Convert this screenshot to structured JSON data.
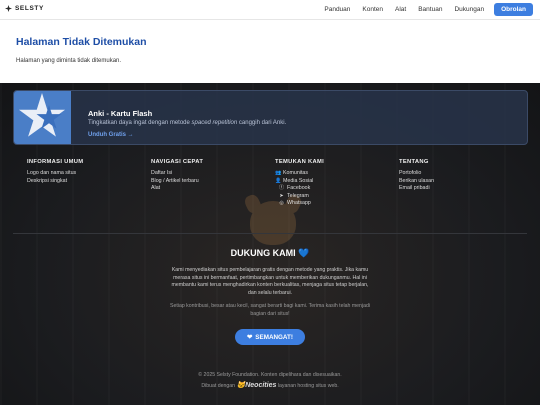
{
  "nav": {
    "brand": "SELSTY",
    "links": [
      "Panduan",
      "Konten",
      "Alat",
      "Bantuan",
      "Dukungan"
    ],
    "cta": "Obrolan"
  },
  "main": {
    "title": "Halaman Tidak Ditemukan",
    "message": "Halaman yang diminta tidak ditemukan."
  },
  "anki": {
    "title": "Anki - Kartu Flash",
    "desc_prefix": "Tingkatkan daya ingat dengan metode ",
    "desc_em": "spaced repetition",
    "desc_suffix": " canggih dari Anki.",
    "link": "Unduh Gratis →"
  },
  "footer": {
    "col1": {
      "title": "INFORMASI UMUM",
      "items": [
        "Logo dan nama situs",
        "Deskripsi singkat"
      ]
    },
    "col2": {
      "title": "NAVIGASI CEPAT",
      "items": [
        "Daftar Isi",
        "Blog / Artikel terbaru",
        "Alat"
      ]
    },
    "col3": {
      "title": "TEMUKAN KAMI",
      "items": [
        {
          "icon": "users-icon",
          "label": "Komunitas"
        },
        {
          "icon": "people-icon",
          "label": "Media Sosial"
        },
        {
          "icon": "facebook-icon",
          "label": "Facebook"
        },
        {
          "icon": "telegram-icon",
          "label": "Telegram"
        },
        {
          "icon": "whatsapp-icon",
          "label": "Whatsapp"
        }
      ]
    },
    "col4": {
      "title": "TENTANG",
      "items": [
        "Portofolio",
        "Berikan ulasan",
        "Email pribadi"
      ]
    }
  },
  "support": {
    "title": "DUKUNG KAMI",
    "text": "Kami menyediakan situs pembelajaran gratis dengan metode yang praktis. Jika kamu merasa situs ini bermanfaat, pertimbangkan untuk memberikan dukunganmu. Hal ini membantu kami terus menghadirkan konten berkualitas, menjaga situs tetap berjalan, dan selalu terbarui.",
    "subtext": "Setiap kontribusi, besar atau kecil, sangat berarti bagi kami. Terima kasih telah menjadi bagian dari situs!",
    "button": "SEMANGAT!"
  },
  "bottom": {
    "copyright": "© 2025 Selsty Foundation. Konten dipelihara dan disesuaikan.",
    "hosting_prefix": "Dibuat dengan",
    "hosting_brand": "Neocities",
    "hosting_suffix": "layanan hosting situs web."
  },
  "colors": {
    "accent": "#3d7ee0",
    "title": "#1e4ea6",
    "footer_bg": "#1c1d20"
  }
}
